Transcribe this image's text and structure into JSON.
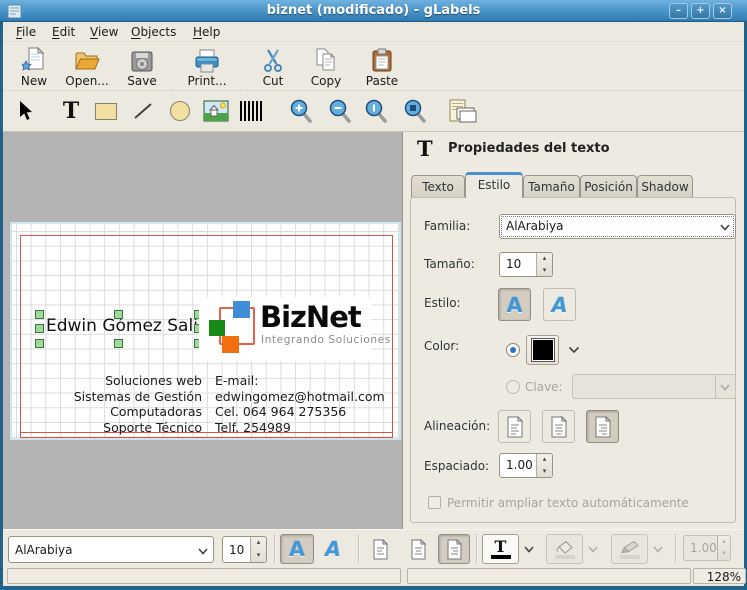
{
  "window": {
    "title": "biznet (modificado) - gLabels"
  },
  "menu": {
    "items": [
      {
        "label": "File"
      },
      {
        "label": "Edit"
      },
      {
        "label": "View"
      },
      {
        "label": "Objects"
      },
      {
        "label": "Help"
      }
    ]
  },
  "toolbar": {
    "new_label": "New",
    "open_label": "Open...",
    "save_label": "Save",
    "print_label": "Print...",
    "cut_label": "Cut",
    "copy_label": "Copy",
    "paste_label": "Paste"
  },
  "icons": {
    "text_tool_glyph": "T",
    "panel_header_glyph": "T",
    "bold_glyph": "A",
    "italic_glyph": "A",
    "text_color_glyph": "T"
  },
  "panel": {
    "title": "Propiedades del texto",
    "tabs": [
      {
        "label": "Texto",
        "active": false
      },
      {
        "label": "Estilo",
        "active": true
      },
      {
        "label": "Tamaño",
        "active": false
      },
      {
        "label": "Posición",
        "active": false
      },
      {
        "label": "Shadow",
        "active": false
      }
    ],
    "familia_label": "Familia:",
    "familia_value": "AlArabiya",
    "tamano_label": "Tamaño:",
    "tamano_value": "10",
    "estilo_label": "Estilo:",
    "color_label": "Color:",
    "color_value": "#000000",
    "clave_label": "Clave:",
    "alineacion_label": "Alineación:",
    "espaciado_label": "Espaciado:",
    "espaciado_value": "1.00",
    "autofit_label": "Permitir ampliar texto automáticamente"
  },
  "card": {
    "name": "Edwin Gómez Salinas",
    "brand": "BizNet",
    "tagline": "Integrando Soluciones",
    "services": [
      "Soluciones web",
      "Sistemas de Gestión",
      "Computadoras",
      "Soporte Técnico"
    ],
    "contact": [
      "E-mail:",
      "edwingomez@hotmail.com",
      "Cel. 064 964 275356",
      "Telf. 254989"
    ],
    "colors": {
      "logo_blue": "#3e8ed8",
      "logo_green": "#178a17",
      "logo_orange": "#f07010",
      "logo_outline": "#e8604a",
      "label_outline": "#dd5246",
      "handle_green": "#a3d79c"
    }
  },
  "bottombar": {
    "font_value": "AlArabiya",
    "size_value": "10",
    "line_width_value": "1.00"
  },
  "statusbar": {
    "zoom_display": "128%"
  }
}
